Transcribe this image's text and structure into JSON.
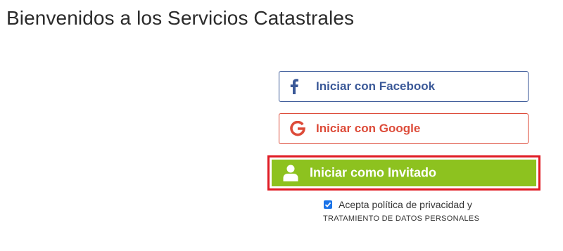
{
  "page": {
    "title": "Bienvenidos a los Servicios Catastrales"
  },
  "login": {
    "facebook": {
      "label": "Iniciar con Facebook",
      "icon": "facebook-icon",
      "color": "#3b5998"
    },
    "google": {
      "label": "Iniciar con Google",
      "icon": "google-icon",
      "color": "#dd4b39"
    },
    "guest": {
      "label": "Iniciar como Invitado",
      "icon": "user-icon",
      "color": "#8dc21f",
      "highlight_color": "#e01b24"
    }
  },
  "consent": {
    "checked": true,
    "text": "Acepta política de privacidad y",
    "link_text": "TRATAMIENTO DE DATOS PERSONALES"
  }
}
